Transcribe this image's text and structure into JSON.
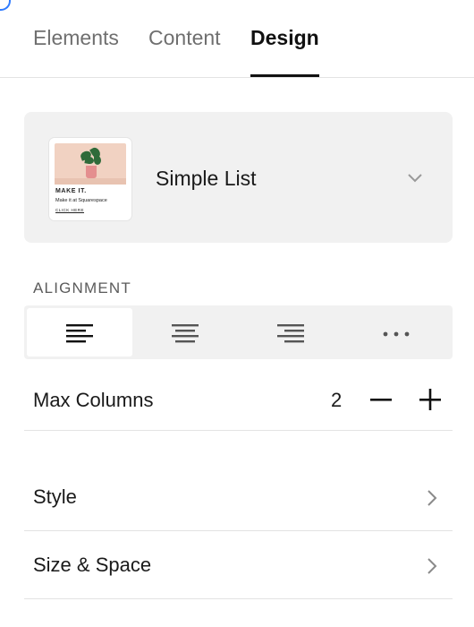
{
  "tabs": [
    {
      "label": "Elements",
      "active": false
    },
    {
      "label": "Content",
      "active": false
    },
    {
      "label": "Design",
      "active": true
    }
  ],
  "layout": {
    "name": "Simple List",
    "thumbnail": {
      "heading": "MAKE IT.",
      "subheading": "Make it at Squarespace",
      "cta": "CLICK HERE"
    },
    "chevron_icon": "chevron-down-icon"
  },
  "alignment": {
    "label": "ALIGNMENT",
    "options": [
      {
        "icon": "align-left-icon",
        "selected": true
      },
      {
        "icon": "align-center-icon",
        "selected": false
      },
      {
        "icon": "align-right-icon",
        "selected": false
      },
      {
        "icon": "more-icon",
        "selected": false
      }
    ]
  },
  "max_columns": {
    "label": "Max Columns",
    "value": "2",
    "decrement_icon": "minus-icon",
    "increment_icon": "plus-icon"
  },
  "rows": {
    "style": {
      "label": "Style",
      "icon": "chevron-right-icon"
    },
    "size_space": {
      "label": "Size & Space",
      "icon": "chevron-right-icon"
    }
  },
  "colors": {
    "accent": "#2f7bff",
    "card_bg": "#f1f1f1",
    "thumb_photo_bg": "#f1d2c2",
    "text_primary": "#1a1a1a",
    "text_muted": "#6f6f6f"
  }
}
